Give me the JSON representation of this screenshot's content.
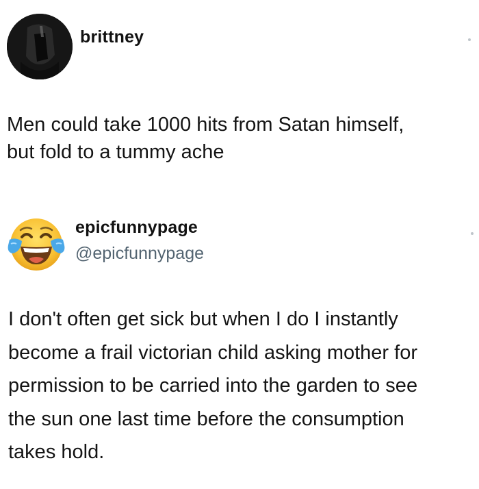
{
  "posts": [
    {
      "display_name": "brittney",
      "avatar_icon": "dark-profile-photo",
      "text_lines": [
        "Men could take 1000 hits from Satan himself,",
        "but fold to a tummy ache"
      ]
    },
    {
      "display_name": "epicfunnypage",
      "handle": "@epicfunnypage",
      "avatar_icon": "face-with-tears-of-joy-emoji",
      "text_lines": [
        "I don't often get sick but when I do I instantly",
        "become a frail victorian child asking mother for",
        "permission to be carried into the garden to see",
        "the sun one last time before the consumption",
        "takes hold."
      ]
    }
  ],
  "colors": {
    "background": "#ffffff",
    "text": "#111111",
    "handle": "#536471",
    "emoji_face": "#f9c134",
    "emoji_tears": "#4aa8e8"
  }
}
